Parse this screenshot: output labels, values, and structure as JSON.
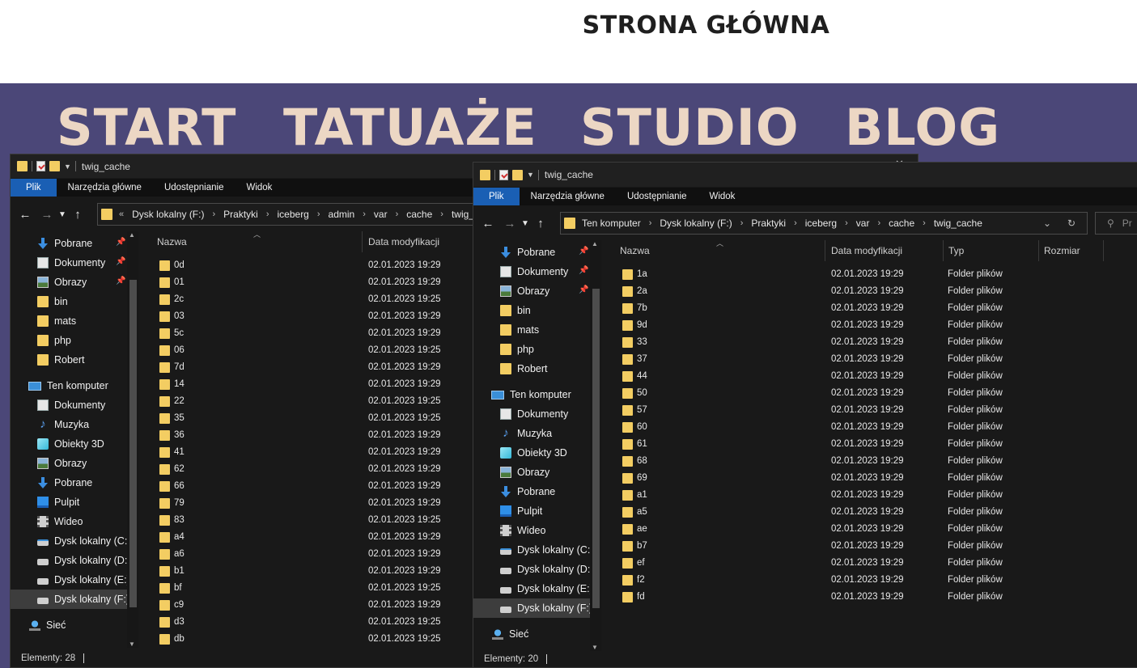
{
  "website": {
    "heading": "STRONA GŁÓWNA",
    "nav": [
      "START",
      "TATUAŻE",
      "STUDIO",
      "BLOG"
    ],
    "nav_bg": "#4b4778",
    "nav_color": "#ecd7c4"
  },
  "window_back": {
    "title": "twig_cache",
    "ribbon_tabs": [
      "Plik",
      "Narzędzia główne",
      "Udostępnianie",
      "Widok"
    ],
    "breadcrumb": [
      "Dysk lokalny (F:)",
      "Praktyki",
      "iceberg",
      "admin",
      "var",
      "cache",
      "twig_cache"
    ],
    "nav_items": [
      {
        "label": "Pobrane",
        "icon": "download-icon",
        "pinned": true
      },
      {
        "label": "Dokumenty",
        "icon": "document-icon",
        "pinned": true
      },
      {
        "label": "Obrazy",
        "icon": "pictures-icon",
        "pinned": true
      },
      {
        "label": "bin",
        "icon": "folder-icon",
        "pinned": false
      },
      {
        "label": "mats",
        "icon": "folder-icon",
        "pinned": false
      },
      {
        "label": "php",
        "icon": "folder-icon",
        "pinned": false
      },
      {
        "label": "Robert",
        "icon": "folder-icon",
        "pinned": false
      },
      {
        "label": "Ten komputer",
        "icon": "computer-icon",
        "pinned": false
      },
      {
        "label": "Dokumenty",
        "icon": "document-icon",
        "pinned": false
      },
      {
        "label": "Muzyka",
        "icon": "music-icon",
        "pinned": false
      },
      {
        "label": "Obiekty 3D",
        "icon": "cube-icon",
        "pinned": false
      },
      {
        "label": "Obrazy",
        "icon": "pictures-icon",
        "pinned": false
      },
      {
        "label": "Pobrane",
        "icon": "download-icon",
        "pinned": false
      },
      {
        "label": "Pulpit",
        "icon": "desktop-icon",
        "pinned": false
      },
      {
        "label": "Wideo",
        "icon": "video-icon",
        "pinned": false
      },
      {
        "label": "Dysk lokalny (C:)",
        "icon": "drive-c-icon",
        "pinned": false
      },
      {
        "label": "Dysk lokalny (D:)",
        "icon": "drive-icon",
        "pinned": false
      },
      {
        "label": "Dysk lokalny (E:)",
        "icon": "drive-icon",
        "pinned": false
      },
      {
        "label": "Dysk lokalny (F:)",
        "icon": "drive-icon",
        "pinned": false,
        "selected": true
      },
      {
        "label": "Sieć",
        "icon": "network-icon",
        "pinned": false
      }
    ],
    "columns": [
      "Nazwa",
      "Data modyfikacji"
    ],
    "files": [
      {
        "name": "0d",
        "date": "02.01.2023 19:29"
      },
      {
        "name": "01",
        "date": "02.01.2023 19:29"
      },
      {
        "name": "2c",
        "date": "02.01.2023 19:25"
      },
      {
        "name": "03",
        "date": "02.01.2023 19:29"
      },
      {
        "name": "5c",
        "date": "02.01.2023 19:29"
      },
      {
        "name": "06",
        "date": "02.01.2023 19:25"
      },
      {
        "name": "7d",
        "date": "02.01.2023 19:29"
      },
      {
        "name": "14",
        "date": "02.01.2023 19:29"
      },
      {
        "name": "22",
        "date": "02.01.2023 19:25"
      },
      {
        "name": "35",
        "date": "02.01.2023 19:25"
      },
      {
        "name": "36",
        "date": "02.01.2023 19:29"
      },
      {
        "name": "41",
        "date": "02.01.2023 19:29"
      },
      {
        "name": "62",
        "date": "02.01.2023 19:29"
      },
      {
        "name": "66",
        "date": "02.01.2023 19:29"
      },
      {
        "name": "79",
        "date": "02.01.2023 19:29"
      },
      {
        "name": "83",
        "date": "02.01.2023 19:25"
      },
      {
        "name": "a4",
        "date": "02.01.2023 19:29"
      },
      {
        "name": "a6",
        "date": "02.01.2023 19:29"
      },
      {
        "name": "b1",
        "date": "02.01.2023 19:29"
      },
      {
        "name": "bf",
        "date": "02.01.2023 19:25"
      },
      {
        "name": "c9",
        "date": "02.01.2023 19:29"
      },
      {
        "name": "d3",
        "date": "02.01.2023 19:25"
      },
      {
        "name": "db",
        "date": "02.01.2023 19:25"
      }
    ],
    "status": "Elementy: 28"
  },
  "window_front": {
    "title": "twig_cache",
    "ribbon_tabs": [
      "Plik",
      "Narzędzia główne",
      "Udostępnianie",
      "Widok"
    ],
    "breadcrumb": [
      "Ten komputer",
      "Dysk lokalny (F:)",
      "Praktyki",
      "iceberg",
      "var",
      "cache",
      "twig_cache"
    ],
    "search_placeholder": "Pr",
    "nav_items": [
      {
        "label": "Pobrane",
        "icon": "download-icon",
        "pinned": true
      },
      {
        "label": "Dokumenty",
        "icon": "document-icon",
        "pinned": true
      },
      {
        "label": "Obrazy",
        "icon": "pictures-icon",
        "pinned": true
      },
      {
        "label": "bin",
        "icon": "folder-icon",
        "pinned": false
      },
      {
        "label": "mats",
        "icon": "folder-icon",
        "pinned": false
      },
      {
        "label": "php",
        "icon": "folder-icon",
        "pinned": false
      },
      {
        "label": "Robert",
        "icon": "folder-icon",
        "pinned": false
      },
      {
        "label": "Ten komputer",
        "icon": "computer-icon",
        "pinned": false
      },
      {
        "label": "Dokumenty",
        "icon": "document-icon",
        "pinned": false
      },
      {
        "label": "Muzyka",
        "icon": "music-icon",
        "pinned": false
      },
      {
        "label": "Obiekty 3D",
        "icon": "cube-icon",
        "pinned": false
      },
      {
        "label": "Obrazy",
        "icon": "pictures-icon",
        "pinned": false
      },
      {
        "label": "Pobrane",
        "icon": "download-icon",
        "pinned": false
      },
      {
        "label": "Pulpit",
        "icon": "desktop-icon",
        "pinned": false
      },
      {
        "label": "Wideo",
        "icon": "video-icon",
        "pinned": false
      },
      {
        "label": "Dysk lokalny (C:)",
        "icon": "drive-c-icon",
        "pinned": false
      },
      {
        "label": "Dysk lokalny (D:)",
        "icon": "drive-icon",
        "pinned": false
      },
      {
        "label": "Dysk lokalny (E:)",
        "icon": "drive-icon",
        "pinned": false
      },
      {
        "label": "Dysk lokalny (F:)",
        "icon": "drive-icon",
        "pinned": false,
        "selected": true
      },
      {
        "label": "Sieć",
        "icon": "network-icon",
        "pinned": false
      }
    ],
    "columns": [
      "Nazwa",
      "Data modyfikacji",
      "Typ",
      "Rozmiar"
    ],
    "files": [
      {
        "name": "1a",
        "date": "02.01.2023 19:29",
        "type": "Folder plików"
      },
      {
        "name": "2a",
        "date": "02.01.2023 19:29",
        "type": "Folder plików"
      },
      {
        "name": "7b",
        "date": "02.01.2023 19:29",
        "type": "Folder plików"
      },
      {
        "name": "9d",
        "date": "02.01.2023 19:29",
        "type": "Folder plików"
      },
      {
        "name": "33",
        "date": "02.01.2023 19:29",
        "type": "Folder plików"
      },
      {
        "name": "37",
        "date": "02.01.2023 19:29",
        "type": "Folder plików"
      },
      {
        "name": "44",
        "date": "02.01.2023 19:29",
        "type": "Folder plików"
      },
      {
        "name": "50",
        "date": "02.01.2023 19:29",
        "type": "Folder plików"
      },
      {
        "name": "57",
        "date": "02.01.2023 19:29",
        "type": "Folder plików"
      },
      {
        "name": "60",
        "date": "02.01.2023 19:29",
        "type": "Folder plików"
      },
      {
        "name": "61",
        "date": "02.01.2023 19:29",
        "type": "Folder plików"
      },
      {
        "name": "68",
        "date": "02.01.2023 19:29",
        "type": "Folder plików"
      },
      {
        "name": "69",
        "date": "02.01.2023 19:29",
        "type": "Folder plików"
      },
      {
        "name": "a1",
        "date": "02.01.2023 19:29",
        "type": "Folder plików"
      },
      {
        "name": "a5",
        "date": "02.01.2023 19:29",
        "type": "Folder plików"
      },
      {
        "name": "ae",
        "date": "02.01.2023 19:29",
        "type": "Folder plików"
      },
      {
        "name": "b7",
        "date": "02.01.2023 19:29",
        "type": "Folder plików"
      },
      {
        "name": "ef",
        "date": "02.01.2023 19:29",
        "type": "Folder plików"
      },
      {
        "name": "f2",
        "date": "02.01.2023 19:29",
        "type": "Folder plików"
      },
      {
        "name": "fd",
        "date": "02.01.2023 19:29",
        "type": "Folder plików"
      }
    ],
    "status": "Elementy: 20"
  }
}
